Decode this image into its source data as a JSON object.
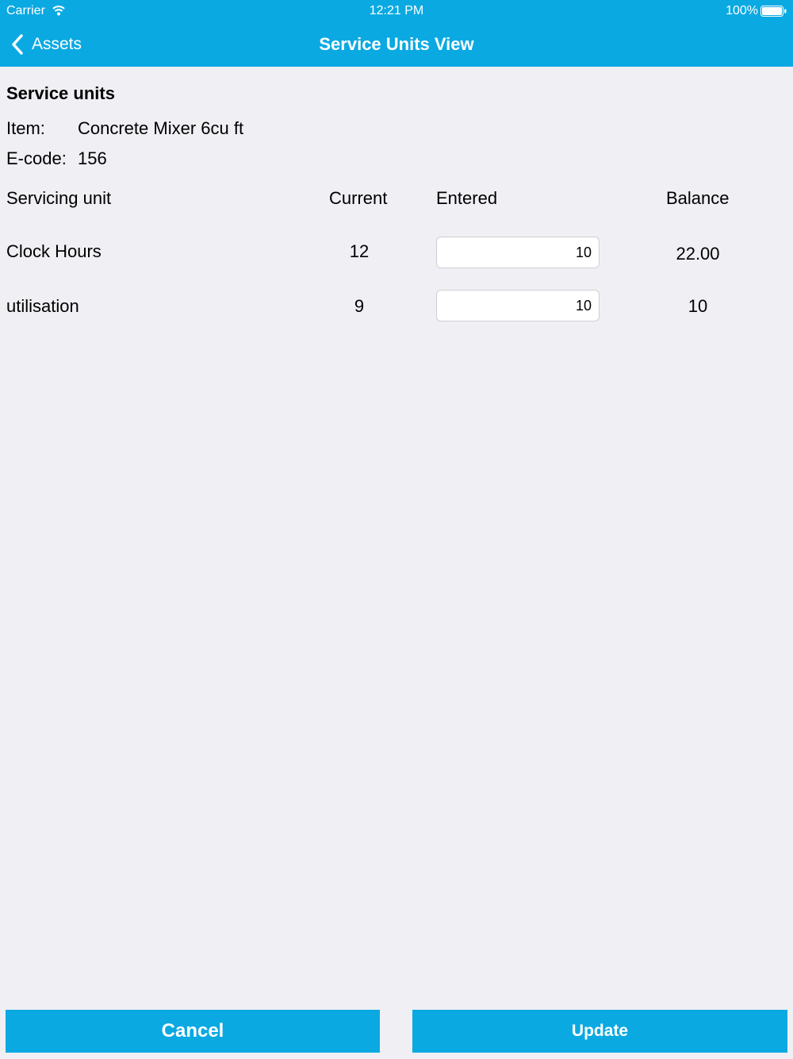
{
  "status_bar": {
    "carrier": "Carrier",
    "time": "12:21 PM",
    "battery": "100%"
  },
  "nav": {
    "back_label": "Assets",
    "title": "Service Units View"
  },
  "section": {
    "title": "Service units",
    "item_label": "Item:",
    "item_value": "Concrete Mixer 6cu ft",
    "ecode_label": "E-code:",
    "ecode_value": "156"
  },
  "table": {
    "headers": {
      "unit": "Servicing unit",
      "current": "Current",
      "entered": "Entered",
      "balance": "Balance"
    },
    "rows": [
      {
        "unit": "Clock Hours",
        "current": "12",
        "entered": "10",
        "balance": "22.00"
      },
      {
        "unit": "utilisation",
        "current": "9",
        "entered": "10",
        "balance": "10"
      }
    ]
  },
  "actions": {
    "cancel_label": "Cancel",
    "update_label": "Update"
  },
  "colors": {
    "accent": "#0aa9e2",
    "background": "#efeff4"
  }
}
